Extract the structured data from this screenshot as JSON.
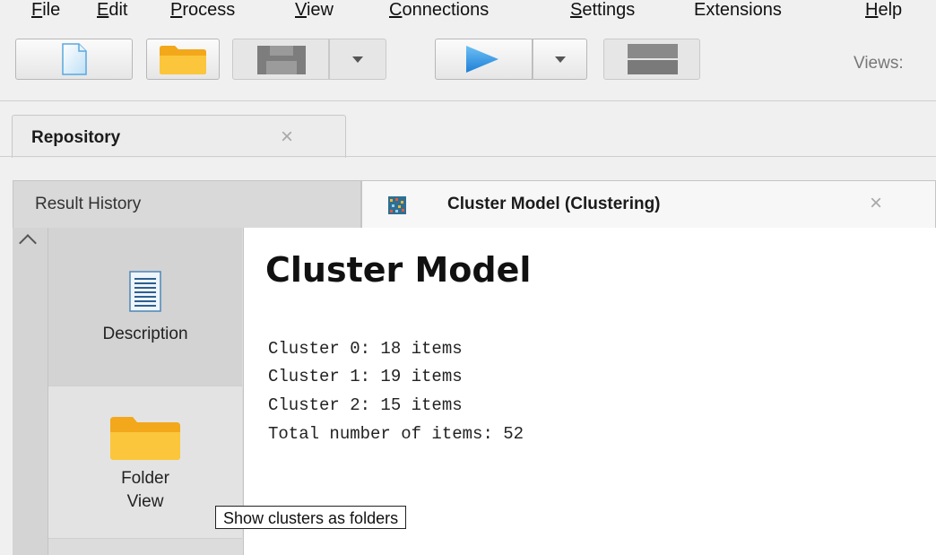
{
  "menu": [
    {
      "mnemonic": "F",
      "rest": "ile"
    },
    {
      "mnemonic": "E",
      "rest": "dit"
    },
    {
      "mnemonic": "P",
      "rest": "rocess"
    },
    {
      "mnemonic": "V",
      "rest": "iew"
    },
    {
      "mnemonic": "C",
      "rest": "onnections"
    },
    {
      "mnemonic": "S",
      "rest": "ettings"
    },
    {
      "mnemonic": "",
      "rest": "Extensions"
    },
    {
      "mnemonic": "H",
      "rest": "elp"
    }
  ],
  "toolbar": {
    "views_label": "Views:",
    "icons": [
      "new-process-icon",
      "open-folder-icon",
      "save-icon",
      "dropdown-caret-icon",
      "run-icon",
      "stop-icon"
    ],
    "accent_run": "#3b9ae8",
    "accent_folder": "#f4b21f"
  },
  "repository_tab": {
    "label": "Repository",
    "close": "×"
  },
  "tabs": {
    "history": {
      "label": "Result History"
    },
    "cluster": {
      "label": "Cluster Model (Clustering)",
      "close": "×"
    }
  },
  "side_panel": {
    "description": {
      "label": "Description",
      "icon": "document-icon"
    },
    "folder_view": {
      "label_line1": "Folder",
      "label_line2": "View",
      "icon": "folder-icon"
    }
  },
  "content": {
    "title": "Cluster Model",
    "lines": [
      "Cluster 0: 18 items",
      "Cluster 1: 19 items",
      "Cluster 2: 15 items",
      "Total number of items: 52"
    ]
  },
  "tooltip": {
    "text": "Show clusters as folders"
  }
}
